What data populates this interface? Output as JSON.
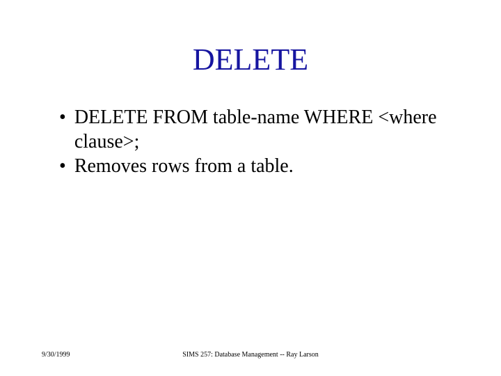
{
  "slide": {
    "title": "DELETE",
    "bullets": [
      "DELETE FROM table-name WHERE <where clause>;",
      "Removes rows from a table."
    ]
  },
  "footer": {
    "date": "9/30/1999",
    "course": "SIMS 257: Database Management -- Ray Larson"
  }
}
